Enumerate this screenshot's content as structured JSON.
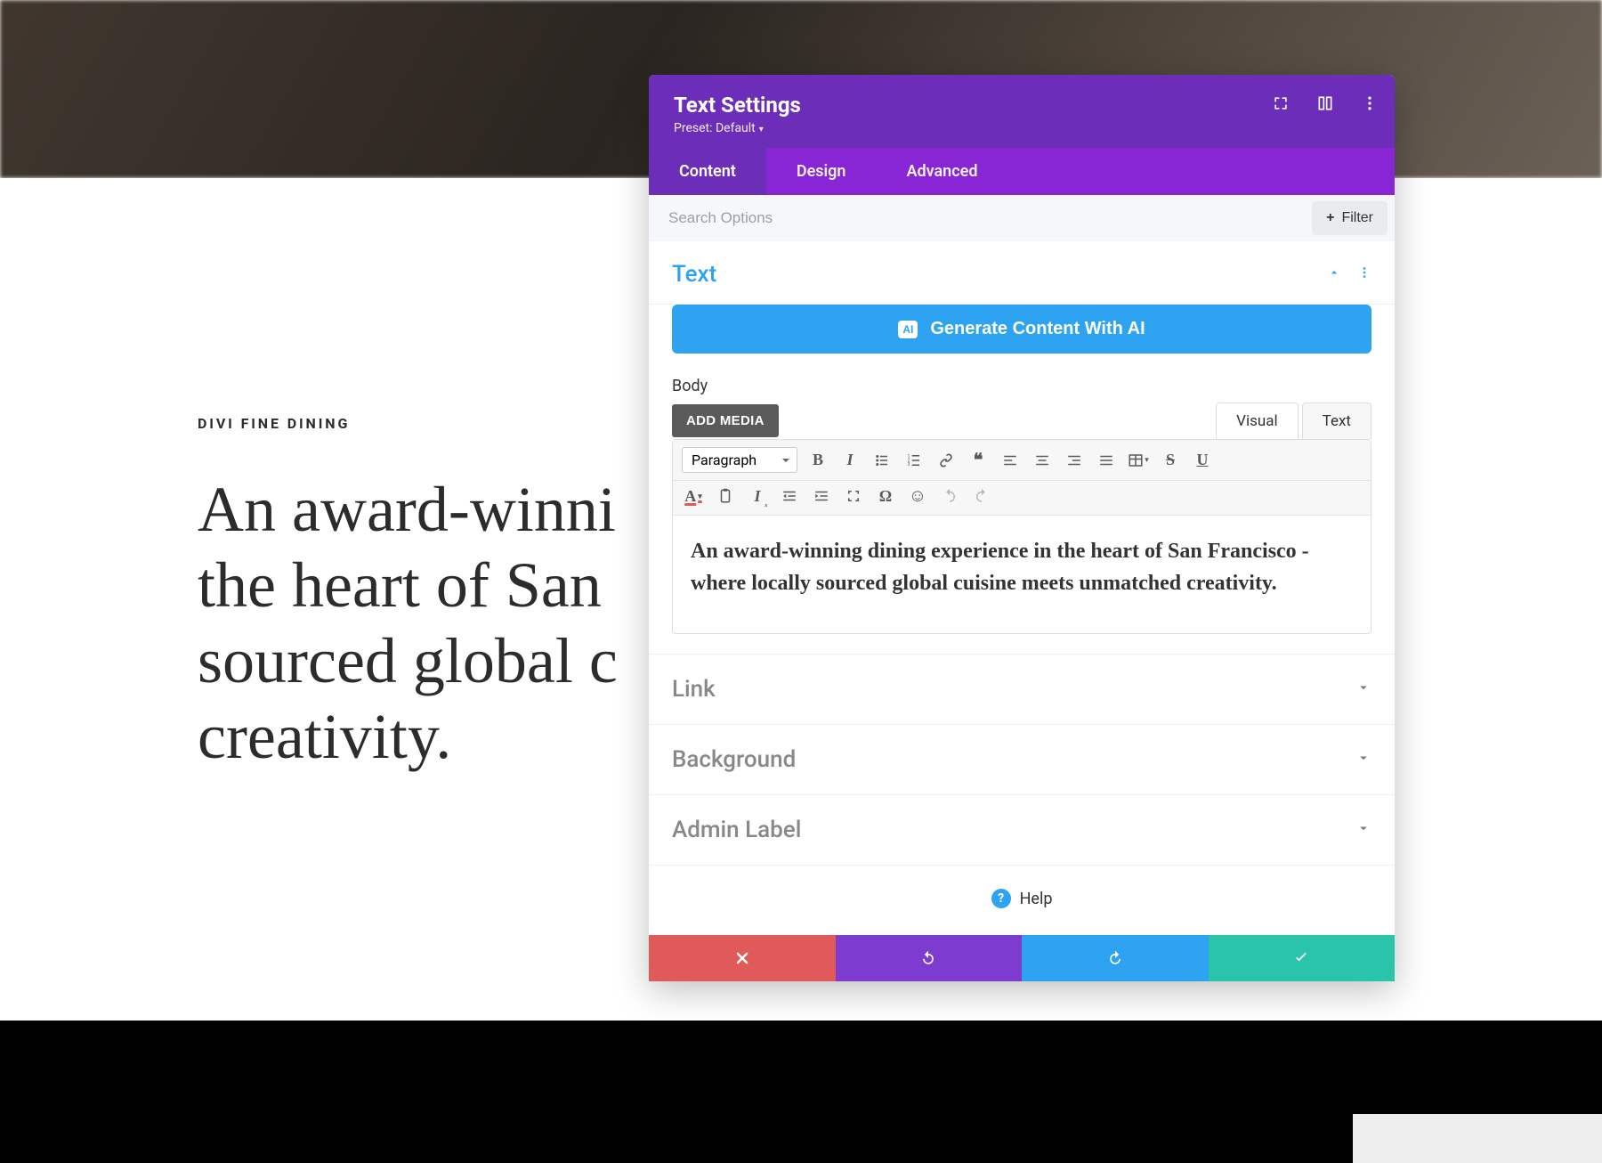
{
  "page": {
    "eyebrow": "DIVI FINE DINING",
    "heading": "An award-winning dining experience in the heart of San Francisco - where locally sourced global cuisine meets unmatched creativity."
  },
  "panel": {
    "title": "Text Settings",
    "preset_label": "Preset: Default",
    "tabs": {
      "content": "Content",
      "design": "Design",
      "advanced": "Advanced",
      "active": "content"
    },
    "search_placeholder": "Search Options",
    "filter_label": "Filter"
  },
  "text_section": {
    "title": "Text",
    "generate_ai_label": "Generate Content With AI",
    "body_label": "Body",
    "add_media_label": "ADD MEDIA",
    "mode_tabs": {
      "visual": "Visual",
      "text": "Text",
      "active": "visual"
    },
    "format_dropdown": "Paragraph",
    "content": "An award-winning dining experience in the heart of San Francisco - where locally sourced global cuisine meets unmatched creativity."
  },
  "collapsed_sections": {
    "link": "Link",
    "background": "Background",
    "admin_label": "Admin Label"
  },
  "help_label": "Help",
  "colors": {
    "primary_purple": "#6c2eb9",
    "tab_purple": "#8826d6",
    "blue": "#2ea3f2",
    "green": "#29c4a9",
    "red": "#e15a5a"
  }
}
